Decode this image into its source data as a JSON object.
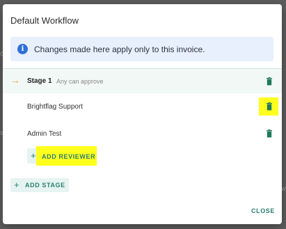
{
  "dialog": {
    "title": "Default Workflow",
    "info": {
      "icon": "info-icon",
      "text": "Changes made here apply only to this invoice."
    },
    "stage": {
      "icon": "arrow-right-icon",
      "name": "Stage 1",
      "rule": "Any can approve"
    },
    "reviewers": [
      {
        "name": "Brightflag Support",
        "delete_icon": "trash-icon"
      },
      {
        "name": "Admin Test",
        "delete_icon": "trash-icon"
      }
    ],
    "add_reviewer_label": "ADD REVIEWER",
    "add_stage_label": "ADD STAGE",
    "close_label": "CLOSE"
  },
  "colors": {
    "accent": "#2a7f6e",
    "trash": "#1f7a5c",
    "highlight": "#ffff1e",
    "info_blue": "#2f6fd8",
    "arrow": "#f0a530"
  }
}
